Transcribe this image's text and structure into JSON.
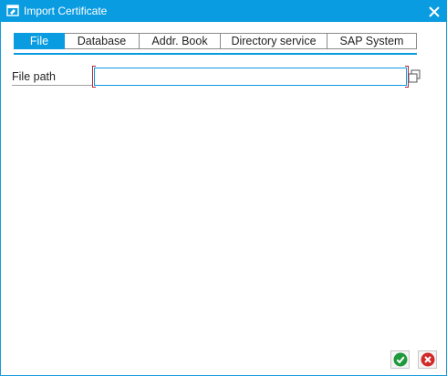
{
  "window": {
    "title": "Import Certificate"
  },
  "icons": {
    "title": "window-edit-icon",
    "close": "close-icon",
    "value_help": "value-help-icon",
    "confirm": "checkmark-icon",
    "cancel": "cancel-icon"
  },
  "tabs": [
    {
      "label": "File",
      "active": true
    },
    {
      "label": "Database",
      "active": false
    },
    {
      "label": "Addr. Book",
      "active": false
    },
    {
      "label": "Directory service",
      "active": false
    },
    {
      "label": "SAP System",
      "active": false
    }
  ],
  "form": {
    "file_path_label": "File path",
    "file_path_value": "",
    "file_path_placeholder": ""
  },
  "colors": {
    "accent": "#0a9ce0",
    "required_bracket": "#b0243b",
    "confirm": "#1e9a3c",
    "cancel": "#d12a2a"
  }
}
